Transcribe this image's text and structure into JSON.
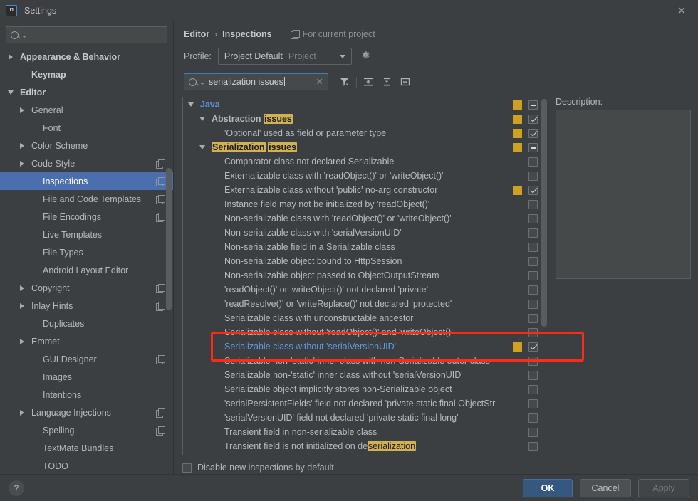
{
  "window": {
    "title": "Settings",
    "logo": "intellij-idea-logo",
    "close_icon": "close-icon"
  },
  "sidebar": {
    "search_placeholder": "",
    "search_value": "",
    "items": [
      {
        "label": "Appearance & Behavior",
        "arrow": "right",
        "bold": true,
        "indent": 0,
        "copy": false,
        "selected": false
      },
      {
        "label": "Keymap",
        "arrow": "none",
        "bold": true,
        "indent": 1,
        "copy": false,
        "selected": false
      },
      {
        "label": "Editor",
        "arrow": "down",
        "bold": true,
        "indent": 0,
        "copy": false,
        "selected": false
      },
      {
        "label": "General",
        "arrow": "right",
        "bold": false,
        "indent": 1,
        "copy": false,
        "selected": false
      },
      {
        "label": "Font",
        "arrow": "none",
        "bold": false,
        "indent": 2,
        "copy": false,
        "selected": false
      },
      {
        "label": "Color Scheme",
        "arrow": "right",
        "bold": false,
        "indent": 1,
        "copy": false,
        "selected": false
      },
      {
        "label": "Code Style",
        "arrow": "right",
        "bold": false,
        "indent": 1,
        "copy": true,
        "selected": false
      },
      {
        "label": "Inspections",
        "arrow": "none",
        "bold": false,
        "indent": 2,
        "copy": true,
        "selected": true
      },
      {
        "label": "File and Code Templates",
        "arrow": "none",
        "bold": false,
        "indent": 2,
        "copy": true,
        "selected": false
      },
      {
        "label": "File Encodings",
        "arrow": "none",
        "bold": false,
        "indent": 2,
        "copy": true,
        "selected": false
      },
      {
        "label": "Live Templates",
        "arrow": "none",
        "bold": false,
        "indent": 2,
        "copy": false,
        "selected": false
      },
      {
        "label": "File Types",
        "arrow": "none",
        "bold": false,
        "indent": 2,
        "copy": false,
        "selected": false
      },
      {
        "label": "Android Layout Editor",
        "arrow": "none",
        "bold": false,
        "indent": 2,
        "copy": false,
        "selected": false
      },
      {
        "label": "Copyright",
        "arrow": "right",
        "bold": false,
        "indent": 1,
        "copy": true,
        "selected": false
      },
      {
        "label": "Inlay Hints",
        "arrow": "right",
        "bold": false,
        "indent": 1,
        "copy": true,
        "selected": false
      },
      {
        "label": "Duplicates",
        "arrow": "none",
        "bold": false,
        "indent": 2,
        "copy": false,
        "selected": false
      },
      {
        "label": "Emmet",
        "arrow": "right",
        "bold": false,
        "indent": 1,
        "copy": false,
        "selected": false
      },
      {
        "label": "GUI Designer",
        "arrow": "none",
        "bold": false,
        "indent": 2,
        "copy": true,
        "selected": false
      },
      {
        "label": "Images",
        "arrow": "none",
        "bold": false,
        "indent": 2,
        "copy": false,
        "selected": false
      },
      {
        "label": "Intentions",
        "arrow": "none",
        "bold": false,
        "indent": 2,
        "copy": false,
        "selected": false
      },
      {
        "label": "Language Injections",
        "arrow": "right",
        "bold": false,
        "indent": 1,
        "copy": true,
        "selected": false
      },
      {
        "label": "Spelling",
        "arrow": "none",
        "bold": false,
        "indent": 2,
        "copy": true,
        "selected": false
      },
      {
        "label": "TextMate Bundles",
        "arrow": "none",
        "bold": false,
        "indent": 2,
        "copy": false,
        "selected": false
      },
      {
        "label": "TODO",
        "arrow": "none",
        "bold": false,
        "indent": 2,
        "copy": false,
        "selected": false
      }
    ]
  },
  "header": {
    "breadcrumb": {
      "parent": "Editor",
      "separator": "›",
      "current": "Inspections"
    },
    "for_current_project": "For current project",
    "profile_label": "Profile:",
    "profile_name": "Project Default",
    "profile_scope": "Project",
    "gear_icon": "gear-icon",
    "filter_search_value": "serialization issues",
    "filter_search_placeholder": "",
    "clear_icon": "clear-icon",
    "toolbar": [
      {
        "icon": "filter-icon",
        "name": "filter-inspections-button"
      },
      {
        "icon": "expand-all-icon",
        "name": "expand-all-button"
      },
      {
        "icon": "collapse-all-icon",
        "name": "collapse-all-button"
      },
      {
        "icon": "toggle-panel-icon",
        "name": "toggle-description-panel-button"
      }
    ]
  },
  "tree": {
    "rows": [
      {
        "text": "Java",
        "level": 0,
        "twisty": "down",
        "bold": true,
        "java": true,
        "severity": true,
        "checkbox": "partial",
        "selected": false,
        "highlights": []
      },
      {
        "text": "Abstraction issues",
        "level": 1,
        "twisty": "down",
        "bold": true,
        "java": false,
        "severity": true,
        "checkbox": "checked",
        "selected": false,
        "highlights": [
          "issues"
        ]
      },
      {
        "text": "'Optional' used as field or parameter type",
        "level": 2,
        "twisty": "none",
        "bold": false,
        "java": false,
        "severity": true,
        "checkbox": "checked",
        "selected": false,
        "highlights": []
      },
      {
        "text": "Serialization issues",
        "level": 1,
        "twisty": "down",
        "bold": true,
        "java": false,
        "severity": true,
        "checkbox": "partial",
        "selected": false,
        "highlights": [
          "Serialization",
          "issues"
        ]
      },
      {
        "text": "Comparator class not declared Serializable",
        "level": 2,
        "twisty": "none",
        "bold": false,
        "java": false,
        "severity": false,
        "checkbox": "empty",
        "selected": false,
        "highlights": []
      },
      {
        "text": "Externalizable class with 'readObject()' or 'writeObject()'",
        "level": 2,
        "twisty": "none",
        "bold": false,
        "java": false,
        "severity": false,
        "checkbox": "empty",
        "selected": false,
        "highlights": []
      },
      {
        "text": "Externalizable class without 'public' no-arg constructor",
        "level": 2,
        "twisty": "none",
        "bold": false,
        "java": false,
        "severity": true,
        "checkbox": "checked",
        "selected": false,
        "highlights": []
      },
      {
        "text": "Instance field may not be initialized by 'readObject()'",
        "level": 2,
        "twisty": "none",
        "bold": false,
        "java": false,
        "severity": false,
        "checkbox": "empty",
        "selected": false,
        "highlights": []
      },
      {
        "text": "Non-serializable class with 'readObject()' or 'writeObject()'",
        "level": 2,
        "twisty": "none",
        "bold": false,
        "java": false,
        "severity": false,
        "checkbox": "empty",
        "selected": false,
        "highlights": []
      },
      {
        "text": "Non-serializable class with 'serialVersionUID'",
        "level": 2,
        "twisty": "none",
        "bold": false,
        "java": false,
        "severity": false,
        "checkbox": "empty",
        "selected": false,
        "highlights": []
      },
      {
        "text": "Non-serializable field in a Serializable class",
        "level": 2,
        "twisty": "none",
        "bold": false,
        "java": false,
        "severity": false,
        "checkbox": "empty",
        "selected": false,
        "highlights": []
      },
      {
        "text": "Non-serializable object bound to HttpSession",
        "level": 2,
        "twisty": "none",
        "bold": false,
        "java": false,
        "severity": false,
        "checkbox": "empty",
        "selected": false,
        "highlights": []
      },
      {
        "text": "Non-serializable object passed to ObjectOutputStream",
        "level": 2,
        "twisty": "none",
        "bold": false,
        "java": false,
        "severity": false,
        "checkbox": "empty",
        "selected": false,
        "highlights": []
      },
      {
        "text": "'readObject()' or 'writeObject()' not declared 'private'",
        "level": 2,
        "twisty": "none",
        "bold": false,
        "java": false,
        "severity": false,
        "checkbox": "empty",
        "selected": false,
        "highlights": []
      },
      {
        "text": "'readResolve()' or 'writeReplace()' not declared 'protected'",
        "level": 2,
        "twisty": "none",
        "bold": false,
        "java": false,
        "severity": false,
        "checkbox": "empty",
        "selected": false,
        "highlights": []
      },
      {
        "text": "Serializable class with unconstructable ancestor",
        "level": 2,
        "twisty": "none",
        "bold": false,
        "java": false,
        "severity": false,
        "checkbox": "empty",
        "selected": false,
        "highlights": []
      },
      {
        "text": "Serializable class without 'readObject()' and 'writeObject()'",
        "level": 2,
        "twisty": "none",
        "bold": false,
        "java": false,
        "severity": false,
        "checkbox": "empty",
        "selected": false,
        "highlights": []
      },
      {
        "text": "Serializable class without 'serialVersionUID'",
        "level": 2,
        "twisty": "none",
        "bold": false,
        "java": false,
        "severity": true,
        "checkbox": "checked",
        "selected": true,
        "highlights": []
      },
      {
        "text": "Serializable non-'static' inner class with non-Serializable outer class",
        "level": 2,
        "twisty": "none",
        "bold": false,
        "java": false,
        "severity": false,
        "checkbox": "empty",
        "selected": false,
        "highlights": []
      },
      {
        "text": "Serializable non-'static' inner class without 'serialVersionUID'",
        "level": 2,
        "twisty": "none",
        "bold": false,
        "java": false,
        "severity": false,
        "checkbox": "empty",
        "selected": false,
        "highlights": []
      },
      {
        "text": "Serializable object implicitly stores non-Serializable object",
        "level": 2,
        "twisty": "none",
        "bold": false,
        "java": false,
        "severity": false,
        "checkbox": "empty",
        "selected": false,
        "highlights": []
      },
      {
        "text": "'serialPersistentFields' field not declared 'private static final ObjectStr",
        "level": 2,
        "twisty": "none",
        "bold": false,
        "java": false,
        "severity": false,
        "checkbox": "empty",
        "selected": false,
        "highlights": []
      },
      {
        "text": "'serialVersionUID' field not declared 'private static final long'",
        "level": 2,
        "twisty": "none",
        "bold": false,
        "java": false,
        "severity": false,
        "checkbox": "empty",
        "selected": false,
        "highlights": []
      },
      {
        "text": "Transient field in non-serializable class",
        "level": 2,
        "twisty": "none",
        "bold": false,
        "java": false,
        "severity": false,
        "checkbox": "empty",
        "selected": false,
        "highlights": []
      },
      {
        "text": "Transient field is not initialized on deserialization",
        "level": 2,
        "twisty": "none",
        "bold": false,
        "java": false,
        "severity": false,
        "checkbox": "empty",
        "selected": false,
        "highlights": [
          "serialization"
        ]
      }
    ]
  },
  "description": {
    "title": "Description:",
    "body": ""
  },
  "options": {
    "disable_new_inspections_label": "Disable new inspections by default",
    "disable_new_inspections_checked": false
  },
  "footer": {
    "help_icon": "?",
    "ok_label": "OK",
    "cancel_label": "Cancel",
    "apply_label": "Apply"
  },
  "colors": {
    "accent_blue": "#4b6eaf",
    "severity_warning": "#d0a020",
    "highlight_yellow": "#d2b155",
    "selected_text": "#5f9be2",
    "annotation_red": "#ff2a18",
    "background": "#3c3f41"
  }
}
